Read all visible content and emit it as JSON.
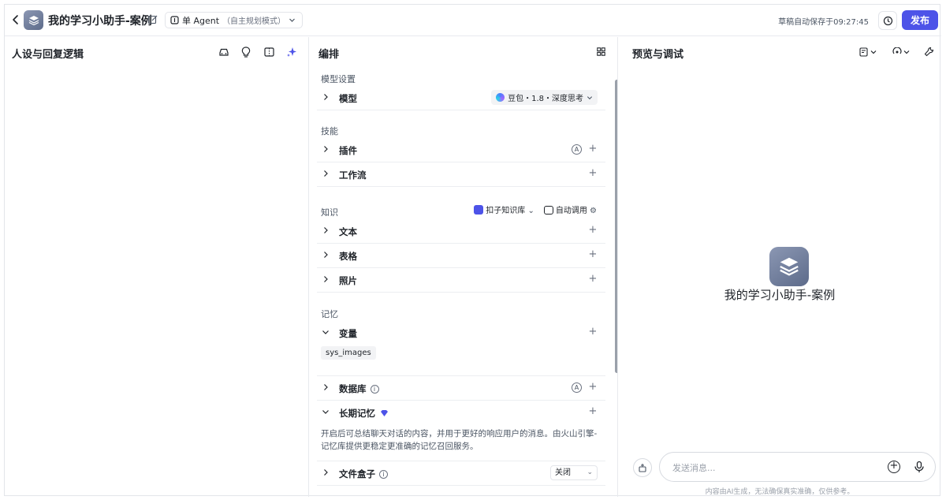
{
  "header": {
    "app_title": "我的学习小助手-案例",
    "mode_label": "单 Agent",
    "mode_sub": "（自主规划模式）",
    "save_status": "草稿自动保存于09:27:45",
    "publish_label": "发布"
  },
  "left_panel": {
    "title": "人设与回复逻辑"
  },
  "mid_panel": {
    "title": "编排",
    "model_section": "模型设置",
    "model_label": "模型",
    "model_value": "豆包・1.8・深度思考",
    "skills_section": "技能",
    "plugin_label": "插件",
    "workflow_label": "工作流",
    "knowledge_section": "知识",
    "kb_source": "扣子知识库",
    "kb_call": "自动调用",
    "text_label": "文本",
    "table_label": "表格",
    "photo_label": "照片",
    "memory_section": "记忆",
    "variable_label": "变量",
    "variable_tag": "sys_images",
    "database_label": "数据库",
    "ltm_label": "长期记忆",
    "ltm_desc": "开启后可总结聊天对话的内容，并用于更好的响应用户的消息。由火山引擎-记忆库提供更稳定更准确的记忆召回服务。",
    "filebox_label": "文件盒子",
    "filebox_value": "关闭",
    "auto_badge": "A",
    "info_badge": "i",
    "plus": "+"
  },
  "right_panel": {
    "title": "预览与调试",
    "bot_name": "我的学习小助手-案例",
    "input_placeholder": "发送消息...",
    "disclaimer": "内容由AI生成，无法确保真实准确，仅供参考。"
  },
  "colors": {
    "accent": "#4d53e8",
    "text": "#1f2329",
    "muted": "#4b5563",
    "border": "#e8eaee"
  },
  "icons": [
    "back-icon",
    "edit-icon",
    "history-icon",
    "car-icon",
    "bulb-icon",
    "layout-icon",
    "sparkle-icon",
    "grid-icon",
    "chevron-right-icon",
    "chevron-down-icon",
    "plus-icon",
    "doubao-icon",
    "kb-icon",
    "gear-icon",
    "premium-icon",
    "info-icon",
    "preview-mode-icon",
    "voice-settings-icon",
    "wrench-icon",
    "clear-icon",
    "mic-icon"
  ]
}
